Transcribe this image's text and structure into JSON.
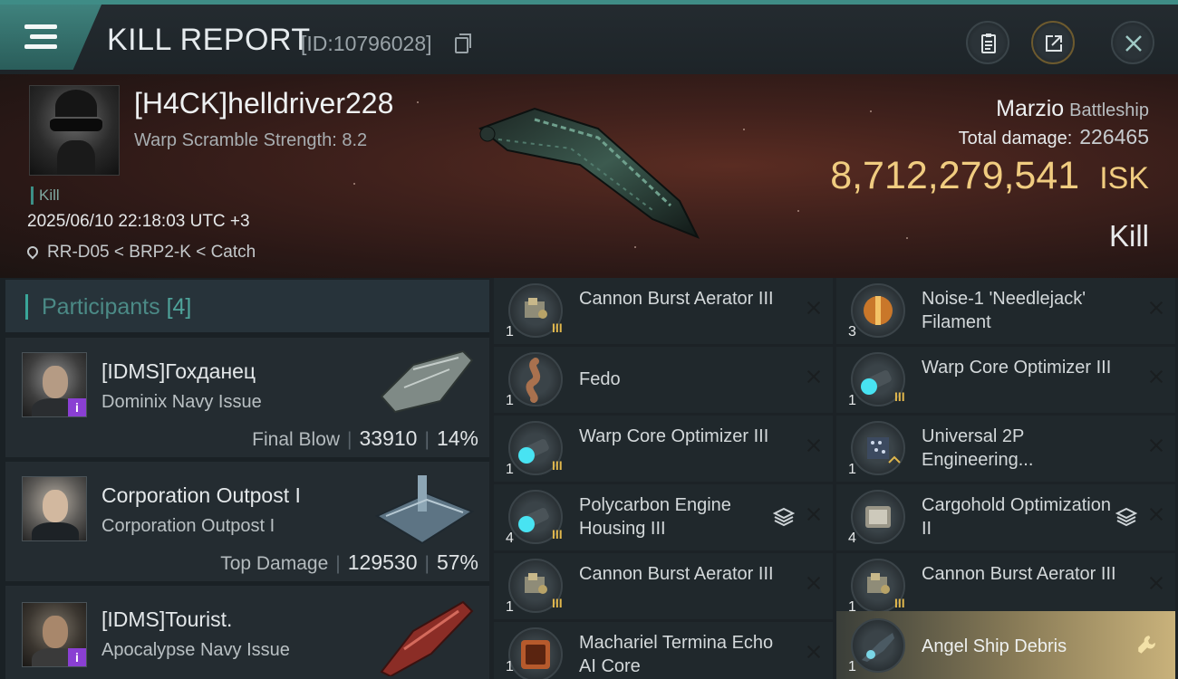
{
  "header": {
    "title": "KILL REPORT",
    "report_id": "[ID:10796028]"
  },
  "victim": {
    "name": "[H4CK]helldriver228",
    "scramble": "Warp Scramble Strength: 8.2",
    "kill_tag": "Kill",
    "datetime": "2025/06/10 22:18:03 UTC +3",
    "location": "RR-D05 < BRP2-K < Catch",
    "ship_name": "Marzio",
    "ship_class": "Battleship",
    "total_damage_label": "Total damage:",
    "total_damage": "226465",
    "isk_value": "8,712,279,541",
    "isk_unit": "ISK",
    "result": "Kill"
  },
  "participants": {
    "label": "Participants",
    "count": "[4]",
    "items": [
      {
        "name": "[IDMS]Гохданец",
        "ship": "Dominix Navy Issue",
        "stat_label": "Final Blow",
        "damage": "33910",
        "percent": "14%"
      },
      {
        "name": "Corporation Outpost I",
        "ship": "Corporation Outpost I",
        "stat_label": "Top Damage",
        "damage": "129530",
        "percent": "57%"
      },
      {
        "name": "[IDMS]Tourist.",
        "ship": "Apocalypse Navy Issue"
      }
    ]
  },
  "items": {
    "col1": [
      {
        "qty": "1",
        "meta": "III",
        "name": "Cannon Burst Aerator III"
      },
      {
        "qty": "1",
        "meta": "",
        "name": "Fedo"
      },
      {
        "qty": "1",
        "meta": "III",
        "name": "Warp Core Optimizer III"
      },
      {
        "qty": "4",
        "meta": "III",
        "name": "Polycarbon Engine Housing III"
      },
      {
        "qty": "1",
        "meta": "III",
        "name": "Cannon Burst Aerator III"
      },
      {
        "qty": "1",
        "meta": "",
        "name": "Machariel Termina Echo AI Core"
      }
    ],
    "col2": [
      {
        "qty": "3",
        "meta": "",
        "name": "Noise-1 'Needlejack' Filament"
      },
      {
        "qty": "1",
        "meta": "III",
        "name": "Warp Core Optimizer III"
      },
      {
        "qty": "1",
        "meta": "",
        "name": "Universal 2P Engineering..."
      },
      {
        "qty": "4",
        "meta": "",
        "name": "Cargohold Optimization II"
      },
      {
        "qty": "1",
        "meta": "III",
        "name": "Cannon Burst Aerator III"
      },
      {
        "qty": "1",
        "meta": "",
        "name": "Angel Ship Debris"
      }
    ]
  },
  "colors": {
    "accent": "#3f8c86",
    "isk": "#f0cc80",
    "gold_row": "#c9b27b",
    "badge": "#8a3fd3"
  }
}
